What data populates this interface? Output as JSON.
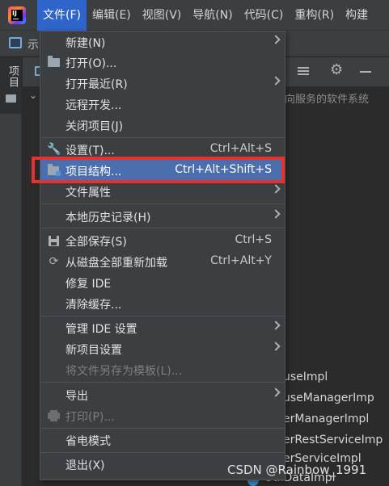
{
  "menubar": {
    "items": [
      {
        "label": "文件(F)",
        "active": true
      },
      {
        "label": "编辑(E)"
      },
      {
        "label": "视图(V)"
      },
      {
        "label": "导航(N)"
      },
      {
        "label": "代码(C)"
      },
      {
        "label": "重构(R)"
      },
      {
        "label": "构建"
      }
    ]
  },
  "toolbar": {
    "project_text": "示"
  },
  "left_strip": {
    "tab_label": "项目"
  },
  "panel": {
    "description": "向服务的软件系统",
    "items": [
      "e",
      "useImpl",
      "useManagerImp",
      "erManagerImpl",
      "erRestServiceImp",
      "erServiceImpl",
      "UtilDataImpl"
    ]
  },
  "file_menu": {
    "items": [
      {
        "label": "新建(N)",
        "submenu": true
      },
      {
        "label": "打开(O)...",
        "icon": "folder-open-icon"
      },
      {
        "label": "打开最近(R)",
        "submenu": true
      },
      {
        "label": "远程开发..."
      },
      {
        "label": "关闭项目(J)"
      },
      {
        "label": "设置(T)...",
        "icon": "wrench-icon",
        "shortcut": "Ctrl+Alt+S"
      },
      {
        "label": "项目结构...",
        "icon": "project-structure-icon",
        "shortcut": "Ctrl+Alt+Shift+S",
        "selected": true
      },
      {
        "label": "文件属性",
        "submenu": true
      },
      {
        "label": "本地历史记录(H)",
        "submenu": true
      },
      {
        "label": "全部保存(S)",
        "icon": "save-icon",
        "shortcut": "Ctrl+S"
      },
      {
        "label": "从磁盘全部重新加载",
        "icon": "reload-icon",
        "shortcut": "Ctrl+Alt+Y"
      },
      {
        "label": "修复 IDE"
      },
      {
        "label": "清除缓存..."
      },
      {
        "label": "管理 IDE 设置",
        "submenu": true
      },
      {
        "label": "新项目设置",
        "submenu": true
      },
      {
        "label": "将文件另存为模板(L)...",
        "disabled": true
      },
      {
        "label": "导出",
        "submenu": true
      },
      {
        "label": "打印(P)...",
        "icon": "print-icon",
        "disabled": true
      },
      {
        "label": "省电模式"
      },
      {
        "label": "退出(X)"
      }
    ]
  },
  "watermark": "CSDN @Rainbow_1991",
  "colors": {
    "menu_bg": "#3c3f41",
    "selection": "#4b6eaf",
    "active_menu": "#2f65ca",
    "highlight_border": "#e8302d"
  }
}
